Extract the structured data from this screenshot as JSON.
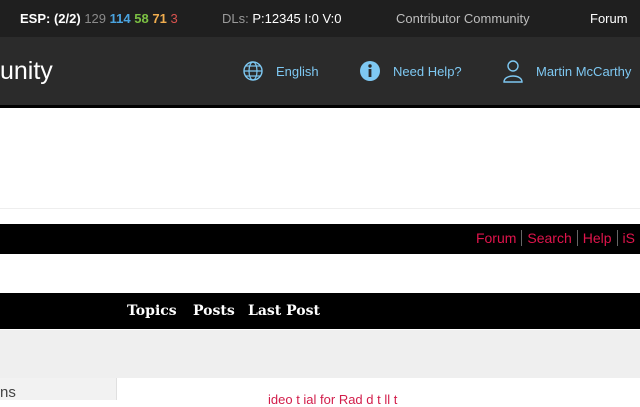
{
  "topbar": {
    "esp_label": "ESP: (2/2)",
    "esp_n1": "129",
    "esp_n2": "114",
    "esp_n3": "58",
    "esp_n4": "71",
    "esp_n5": "3",
    "dls_label": "DLs:",
    "dls_value": "P:12345 I:0 V:0",
    "contributor": "Contributor Community",
    "forum": "Forum"
  },
  "header": {
    "brand": "unity",
    "language": "English",
    "help": "Need Help?",
    "user": "Martin McCarthy"
  },
  "nav": {
    "links": [
      "Forum",
      "Search",
      "Help",
      "iS"
    ]
  },
  "columns": {
    "topics": "Topics",
    "posts": "Posts",
    "last_post": "Last Post"
  },
  "lower": {
    "left_text": "ns",
    "link_text": "ideo t    ial    for Rad   d    t  ll    t"
  },
  "colors": {
    "topbar_bg": "#1f1f1f",
    "header_bg": "#2b2b2b",
    "accent_link": "#7ec8f2",
    "nav_link": "#e0144c"
  }
}
